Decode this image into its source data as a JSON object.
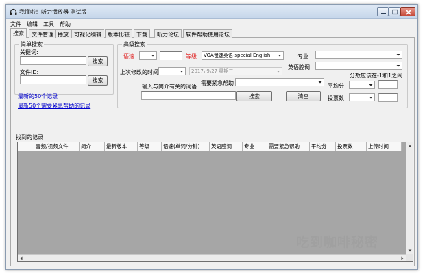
{
  "window": {
    "title": "我懂啦！听力播放器 测试版"
  },
  "menu": [
    "文件",
    "编辑",
    "工具",
    "帮助"
  ],
  "tabs": [
    "搜索",
    "文件管理",
    "播放",
    "可视化编辑",
    "版本比较",
    "下载",
    "听力论坛",
    "软件帮助使用论坛"
  ],
  "simple_search": {
    "title": "简单搜索",
    "keyword_label": "关键词:",
    "file_id_label": "文件ID:",
    "search_button": "搜索",
    "search_button_2": "搜索",
    "link_latest": "最新的50个记录",
    "link_help": "最新50个需要紧急帮助的记录"
  },
  "advanced_search": {
    "title": "高级搜索",
    "speed_label": "语速",
    "level_label": "等级",
    "level_value": "VOA慢速英语-special English",
    "major_label": "专业",
    "accent_label": "英语腔调",
    "last_modified_label": "上次修改的时间:",
    "date_value": "2017\\ 9\\27  星期三",
    "score_range_note": "分数应该在-1和1之间",
    "intro_words_label": "输入与简介有关的词语",
    "need_help_label": "需要紧急帮助",
    "avg_score_label": "平均分",
    "votes_label": "投票数",
    "search_button": "搜索",
    "clear_button": "清空"
  },
  "records": {
    "title": "找到的记录",
    "columns": [
      "音频/视频文件",
      "简介",
      "最新版本",
      "等级",
      "语速(单词/分钟)",
      "英语腔调",
      "专业",
      "需要紧急帮助",
      "平均分",
      "投票数",
      "上传时间"
    ]
  },
  "watermark": "吃到咖啡秘密"
}
